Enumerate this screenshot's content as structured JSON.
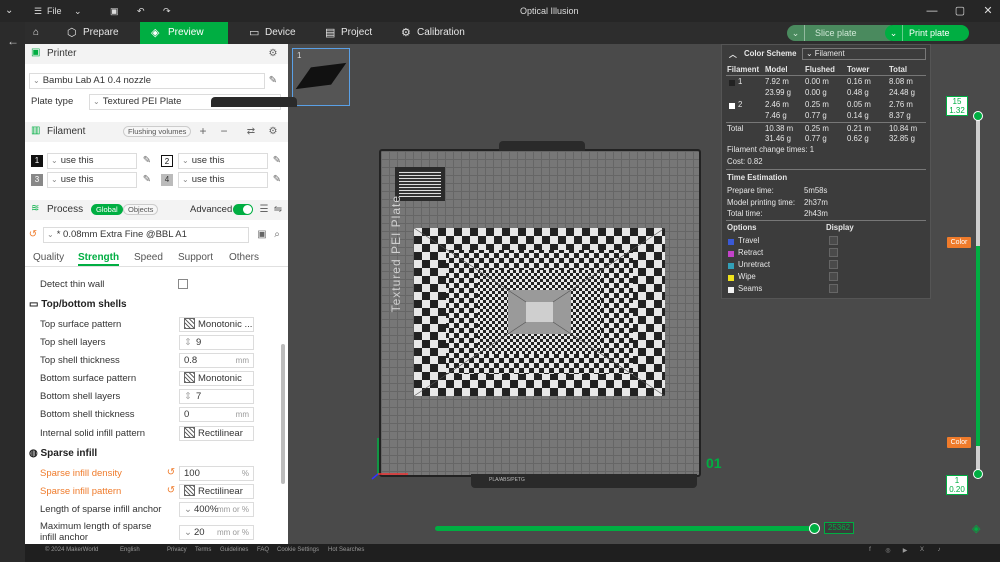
{
  "titlebar": {
    "file_label": "File",
    "title": "Optical Illusion"
  },
  "tabs": [
    {
      "label": "Prepare"
    },
    {
      "label": "Preview"
    },
    {
      "label": "Device"
    },
    {
      "label": "Project"
    },
    {
      "label": "Calibration"
    }
  ],
  "actions": {
    "slice": "Slice plate",
    "print": "Print plate"
  },
  "printer": {
    "section": "Printer",
    "name": "Bambu Lab A1 0.4 nozzle",
    "plate_type_label": "Plate type",
    "plate_type": "Textured PEI Plate"
  },
  "filament": {
    "section": "Filament",
    "flush_btn": "Flushing volumes",
    "slots": [
      {
        "num": "1",
        "value": "use this"
      },
      {
        "num": "2",
        "value": "use this"
      },
      {
        "num": "3",
        "value": "use this"
      },
      {
        "num": "4",
        "value": "use this"
      }
    ]
  },
  "process": {
    "section": "Process",
    "global": "Global",
    "objects": "Objects",
    "advanced": "Advanced",
    "preset": "* 0.08mm Extra Fine @BBL A1",
    "subtabs": [
      "Quality",
      "Strength",
      "Speed",
      "Support",
      "Others"
    ],
    "detect_thin_wall": "Detect thin wall",
    "shells_head": "Top/bottom shells",
    "top_pattern_label": "Top surface pattern",
    "top_pattern": "Monotonic ...",
    "top_layers_label": "Top shell layers",
    "top_layers": "9",
    "top_thick_label": "Top shell thickness",
    "top_thick": "0.8",
    "bottom_pattern_label": "Bottom surface pattern",
    "bottom_pattern": "Monotonic",
    "bottom_layers_label": "Bottom shell layers",
    "bottom_layers": "7",
    "bottom_thick_label": "Bottom shell thickness",
    "bottom_thick": "0",
    "internal_label": "Internal solid infill pattern",
    "internal": "Rectilinear",
    "sparse_head": "Sparse infill",
    "density_label": "Sparse infill density",
    "density": "100",
    "sparse_pattern_label": "Sparse infill pattern",
    "sparse_pattern": "Rectilinear",
    "anchor_label": "Length of sparse infill anchor",
    "anchor": "400%",
    "anchor_unit": "mm or %",
    "max_anchor_label": "Maximum length of sparse infill anchor",
    "max_anchor": "20",
    "max_anchor_unit": "mm or %",
    "unit_mm": "mm",
    "unit_pct": "%"
  },
  "footer": {
    "copyright": "© 2024 MakerWorld",
    "lang": "English",
    "links": [
      "Privacy",
      "Terms",
      "Guidelines",
      "FAQ",
      "Cookie Settings",
      "Hot Searches"
    ]
  },
  "viewport": {
    "thumb_num": "1",
    "plate_label": "Textured PEI Plate",
    "plate_number": "01",
    "plate_bottom_text": "PLA/ABS/PETG",
    "layer_top_num": "15",
    "layer_top_h": "1.32",
    "layer_bot_num": "1",
    "layer_bot_h": "0.20",
    "color_btn": "Color",
    "move_value": "25362"
  },
  "color_scheme": {
    "title": "Color Scheme",
    "mode": "Filament",
    "headers": [
      "Filament",
      "Model",
      "Flushed",
      "Tower",
      "Total"
    ],
    "rows": [
      {
        "id": "1",
        "model_m": "7.92 m",
        "model_g": "23.99 g",
        "flushed_m": "0.00 m",
        "flushed_g": "0.00 g",
        "tower_m": "0.16 m",
        "tower_g": "0.48 g",
        "total_m": "8.08 m",
        "total_g": "24.48 g",
        "color": "#222222"
      },
      {
        "id": "2",
        "model_m": "2.46 m",
        "model_g": "7.46 g",
        "flushed_m": "0.25 m",
        "flushed_g": "0.77 g",
        "tower_m": "0.05 m",
        "tower_g": "0.14 g",
        "total_m": "2.76 m",
        "total_g": "8.37 g",
        "color": "#ffffff"
      }
    ],
    "total_label": "Total",
    "total": {
      "model_m": "10.38 m",
      "model_g": "31.46 g",
      "flushed_m": "0.25 m",
      "flushed_g": "0.77 g",
      "tower_m": "0.21 m",
      "tower_g": "0.62 g",
      "total_m": "10.84 m",
      "total_g": "32.85 g"
    },
    "change_times": "Filament change times:  1",
    "cost": "Cost:  0.82",
    "time_head": "Time Estimation",
    "prepare_label": "Prepare time:",
    "prepare": "5m58s",
    "model_time_label": "Model printing time:",
    "model_time": "2h37m",
    "total_time_label": "Total time:",
    "total_time": "2h43m",
    "options_head": "Options",
    "display_head": "Display",
    "options": [
      {
        "label": "Travel",
        "color": "#3a59d6"
      },
      {
        "label": "Retract",
        "color": "#c342c9"
      },
      {
        "label": "Unretract",
        "color": "#32a0b8"
      },
      {
        "label": "Wipe",
        "color": "#f0e21c"
      },
      {
        "label": "Seams",
        "color": "#f2f2f2"
      }
    ]
  }
}
